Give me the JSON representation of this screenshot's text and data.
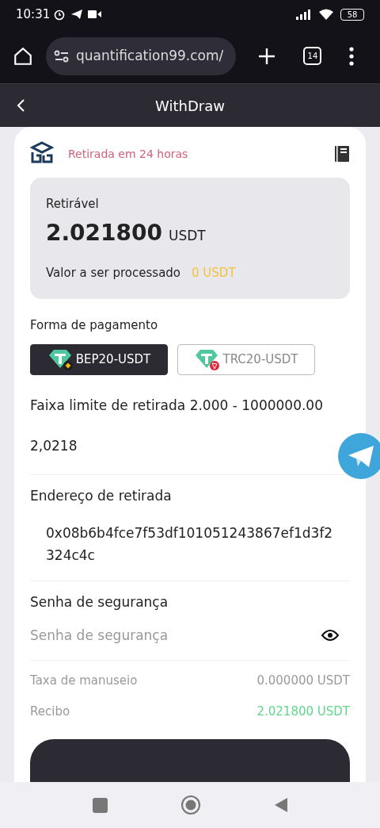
{
  "status_bar": {
    "time": "10:31",
    "battery": "58"
  },
  "browser": {
    "url": "quantification99.com/",
    "tab_count": "14"
  },
  "header": {
    "title": "WithDraw"
  },
  "notice": "Retirada em 24 horas",
  "balance": {
    "label": "Retirável",
    "amount": "2.021800",
    "unit": "USDT",
    "pending_label": "Valor a ser processado",
    "pending_value": "0 USDT"
  },
  "payment": {
    "label": "Forma de pagamento",
    "methods": [
      {
        "label": "BEP20-USDT",
        "kind": "bnb",
        "selected": true
      },
      {
        "label": "TRC20-USDT",
        "kind": "tron",
        "selected": false
      }
    ]
  },
  "limit_text": "Faixa limite de retirada 2.000 - 1000000.00",
  "amount_value": "2,0218",
  "address": {
    "label": "Endereço de retirada",
    "value": "0x08b6b4fce7f53df101051243867ef1d3f2324c4c"
  },
  "password": {
    "label": "Senha de segurança",
    "placeholder": "Senha de segurança"
  },
  "summary": [
    {
      "label": "Taxa de manuseio",
      "value": "0.000000 USDT",
      "kind": "plain"
    },
    {
      "label": "Recibo",
      "value": "2.021800 USDT",
      "kind": "highlight"
    }
  ]
}
